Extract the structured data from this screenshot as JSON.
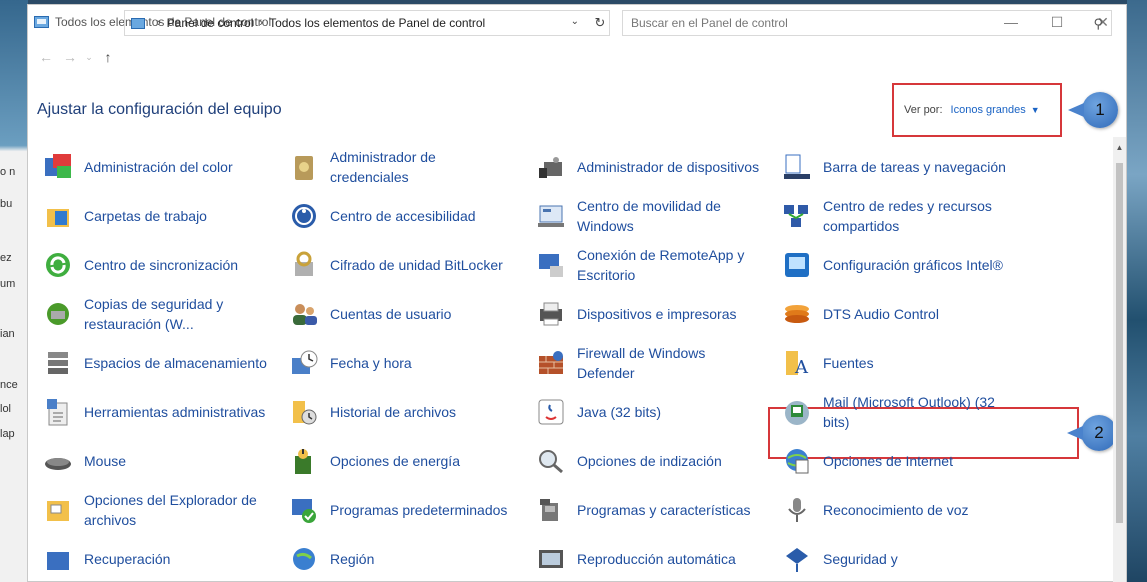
{
  "window": {
    "title": "Todos los elementos de Panel de control",
    "controls": {
      "minimize": "—",
      "maximize": "☐",
      "close": "✕"
    }
  },
  "nav": {
    "back": "←",
    "forward": "→",
    "recent": "⌄",
    "up": "↑",
    "breadcrumb": [
      "Panel de control",
      "Todos los elementos de Panel de control"
    ],
    "separator": "›",
    "dropdown": "⌄",
    "refresh": "↻",
    "search_placeholder": "Buscar en el Panel de control",
    "search_icon": "⚲"
  },
  "header": {
    "title": "Ajustar la configuración del equipo",
    "view_by_label": "Ver por:",
    "view_by_value": "Iconos grandes",
    "view_by_caret": "▼"
  },
  "annotations": {
    "badge1": "1",
    "badge2": "2"
  },
  "desktop_fragments": [
    "o n",
    "bu",
    "ez",
    "um",
    "ian",
    "nce",
    "lol",
    "lap"
  ],
  "items": [
    {
      "label": "Administración del color",
      "icon": "color-management-icon"
    },
    {
      "label": "Administrador de credenciales",
      "icon": "credential-manager-icon"
    },
    {
      "label": "Administrador de dispositivos",
      "icon": "device-manager-icon"
    },
    {
      "label": "Barra de tareas y navegación",
      "icon": "taskbar-icon"
    },
    {
      "label": "Carpetas de trabajo",
      "icon": "work-folders-icon"
    },
    {
      "label": "Centro de accesibilidad",
      "icon": "accessibility-icon"
    },
    {
      "label": "Centro de movilidad de Windows",
      "icon": "mobility-center-icon"
    },
    {
      "label": "Centro de redes y recursos compartidos",
      "icon": "network-center-icon"
    },
    {
      "label": "Centro de sincronización",
      "icon": "sync-center-icon"
    },
    {
      "label": "Cifrado de unidad BitLocker",
      "icon": "bitlocker-icon"
    },
    {
      "label": "Conexión de RemoteApp y Escritorio",
      "icon": "remoteapp-icon"
    },
    {
      "label": "Configuración gráficos Intel®",
      "icon": "intel-graphics-icon"
    },
    {
      "label": "Copias de seguridad y restauración (W...",
      "icon": "backup-icon"
    },
    {
      "label": "Cuentas de usuario",
      "icon": "user-accounts-icon"
    },
    {
      "label": "Dispositivos e impresoras",
      "icon": "printers-icon"
    },
    {
      "label": "DTS Audio Control",
      "icon": "dts-audio-icon"
    },
    {
      "label": "Espacios de almacenamiento",
      "icon": "storage-spaces-icon"
    },
    {
      "label": "Fecha y hora",
      "icon": "date-time-icon"
    },
    {
      "label": "Firewall de Windows Defender",
      "icon": "firewall-icon"
    },
    {
      "label": "Fuentes",
      "icon": "fonts-icon"
    },
    {
      "label": "Herramientas administrativas",
      "icon": "admin-tools-icon"
    },
    {
      "label": "Historial de archivos",
      "icon": "file-history-icon"
    },
    {
      "label": "Java (32 bits)",
      "icon": "java-icon"
    },
    {
      "label": "Mail (Microsoft Outlook) (32 bits)",
      "icon": "mail-icon"
    },
    {
      "label": "Mouse",
      "icon": "mouse-icon"
    },
    {
      "label": "Opciones de energía",
      "icon": "power-options-icon"
    },
    {
      "label": "Opciones de indización",
      "icon": "indexing-icon"
    },
    {
      "label": "Opciones de Internet",
      "icon": "internet-options-icon"
    },
    {
      "label": "Opciones del Explorador de archivos",
      "icon": "explorer-options-icon"
    },
    {
      "label": "Programas predeterminados",
      "icon": "default-programs-icon"
    },
    {
      "label": "Programas y características",
      "icon": "programs-features-icon"
    },
    {
      "label": "Reconocimiento de voz",
      "icon": "speech-recognition-icon"
    },
    {
      "label": "Recuperación",
      "icon": "recovery-icon"
    },
    {
      "label": "Región",
      "icon": "region-icon"
    },
    {
      "label": "Reproducción automática",
      "icon": "autoplay-icon"
    },
    {
      "label": "Seguridad y",
      "icon": "security-icon"
    }
  ],
  "colors": {
    "link": "#1f4e9e",
    "accent": "#1a63c4",
    "highlight": "#d6373a"
  }
}
